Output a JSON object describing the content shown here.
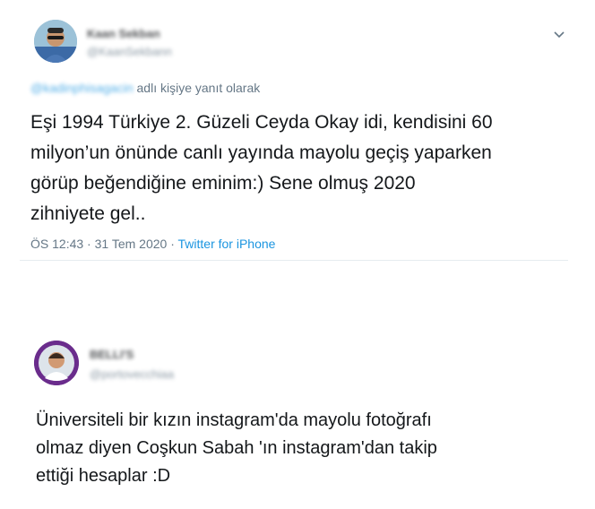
{
  "tweet1": {
    "author_name": "Kaan Sekban",
    "author_handle": "@KaanSekbann",
    "reply_to_handle": "@kadinphisagacin",
    "reply_suffix": "adlı kişiye yanıt olarak",
    "text_lines": [
      "Eşi 1994 Türkiye 2. Güzeli Ceyda Okay idi, kendisini 60",
      "milyon’un önünde canlı yayında mayolu geçiş yaparken",
      "görüp beğendiğine eminim:) Sene olmuş 2020",
      "zihniyete gel.."
    ],
    "time": "ÖS 12:43",
    "separator": "·",
    "date": "31 Tem 2020",
    "source": "Twitter for iPhone"
  },
  "tweet2": {
    "author_name": "BELLI'S",
    "author_handle": "@portovecchiaa",
    "text_lines": [
      "Üniversiteli bir kızın instagram'da mayolu fotoğrafı",
      "olmaz diyen Coşkun Sabah 'ın instagram'dan takip",
      "ettiği hesaplar  :D"
    ]
  },
  "icons": {
    "menu": "chevron-down-icon",
    "avatar1": "avatar",
    "avatar2": "avatar"
  },
  "colors": {
    "text": "#14171a",
    "secondary": "#657786",
    "link": "#1b95e0",
    "avatar2_ring": "#6a2c8c"
  }
}
